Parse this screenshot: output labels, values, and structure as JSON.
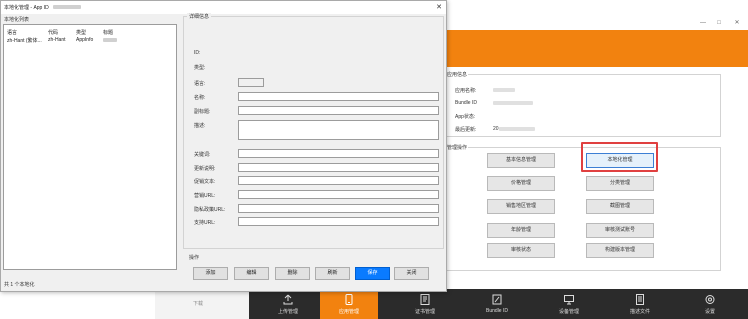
{
  "back_window": {
    "controls": {
      "minimize": "—",
      "maximize": "□",
      "close": "✕"
    },
    "app_info": {
      "title": "应用信息",
      "rows": [
        {
          "label": "应用名称:",
          "value_blurred": true
        },
        {
          "label": "Bundle ID",
          "value_blurred": true
        },
        {
          "label": "App状态:",
          "value_blurred": false
        },
        {
          "label": "最后更新:",
          "value": "20",
          "value_blurred": true
        }
      ]
    },
    "operations": {
      "title": "管理操作",
      "buttons": [
        "基本信息管理",
        "本地化管理",
        "价格管理",
        "分类管理",
        "销售地区管理",
        "截图管理",
        "年龄管理",
        "审核测试账号",
        "审核状态",
        "构建版本管理"
      ],
      "selected": "本地化管理"
    },
    "accent_color": "#f2820f",
    "highlight_color": "#e04040"
  },
  "bottom_nav": {
    "items": [
      {
        "label": "上传管理",
        "icon": "upload-icon",
        "active": false
      },
      {
        "label": "应用管理",
        "icon": "phone-icon",
        "active": true
      },
      {
        "label": "证书管理",
        "icon": "certificate-icon",
        "active": false
      },
      {
        "label": "Bundle ID",
        "icon": "edit-icon",
        "active": false
      },
      {
        "label": "设备管理",
        "icon": "device-icon",
        "active": false
      },
      {
        "label": "描述文件",
        "icon": "profile-icon",
        "active": false
      },
      {
        "label": "设置",
        "icon": "settings-icon",
        "active": false
      }
    ]
  },
  "background_text": "下载",
  "front_window": {
    "title": "本地化管理 - App ID",
    "close": "✕",
    "list": {
      "label": "本地化列表",
      "columns": [
        "语言",
        "代码",
        "类型",
        "标题"
      ],
      "rows": [
        {
          "language": "zh-Hant (繁体...",
          "code": "zh-Hant",
          "type": "AppInfo",
          "title_blurred": true
        }
      ]
    },
    "status": "共 1 个本地化",
    "details": {
      "title": "详细信息",
      "fields": [
        {
          "label": "ID:",
          "kind": "none"
        },
        {
          "label": "类型:",
          "kind": "none"
        },
        {
          "label": "语言:",
          "kind": "small"
        },
        {
          "label": "名称:",
          "kind": "input"
        },
        {
          "label": "副标题:",
          "kind": "input"
        },
        {
          "label": "描述:",
          "kind": "tall"
        },
        {
          "label": "关键词:",
          "kind": "input"
        },
        {
          "label": "更新说明:",
          "kind": "input"
        },
        {
          "label": "促销文本:",
          "kind": "input"
        },
        {
          "label": "营销URL:",
          "kind": "input"
        },
        {
          "label": "隐私政策URL:",
          "kind": "input"
        },
        {
          "label": "支持URL:",
          "kind": "input"
        }
      ]
    },
    "actions": {
      "title": "操作",
      "buttons": [
        "添加",
        "编辑",
        "删除",
        "刷新",
        "保存",
        "关闭"
      ],
      "primary": "保存"
    }
  }
}
